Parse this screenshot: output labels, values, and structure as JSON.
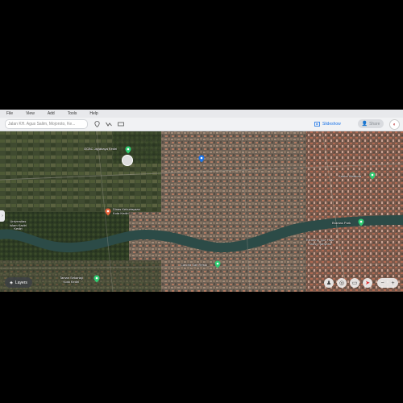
{
  "menu": [
    "File",
    "View",
    "Add",
    "Tools",
    "Help"
  ],
  "search": {
    "placeholder": "Jalan KH. Agus Salim, Mojoroto, Ke..."
  },
  "toolbar": {
    "slideshow_label": "Slideshow",
    "share_label": "Share"
  },
  "map": {
    "labels": [
      {
        "id": "ocbc",
        "text": "OCBC Jayabaya Kediri"
      },
      {
        "id": "dinas",
        "text": "Dinas Kebudayaan\nKota Kediri"
      },
      {
        "id": "unisk",
        "text": "Universitas\nIslam Kadiri\nKediri"
      },
      {
        "id": "brantas",
        "text": "Brantas Park"
      },
      {
        "id": "klenteng",
        "text": "Klenteng Tjoe Hwie\nKiong Tjahyono"
      },
      {
        "id": "candra",
        "text": "Candra Sari Resto"
      },
      {
        "id": "pondok",
        "text": "Taman Sekartaji\nKota Kediri"
      },
      {
        "id": "east",
        "text": "Kantor Walikota"
      }
    ]
  },
  "controls": {
    "layers_label": "Layers",
    "zoom_minus": "−",
    "zoom_plus": "+"
  },
  "colors": {
    "accent": "#1a73e8",
    "river": "#2c4b47",
    "pin_green": "#2ecc71",
    "pin_orange": "#e8643c"
  }
}
